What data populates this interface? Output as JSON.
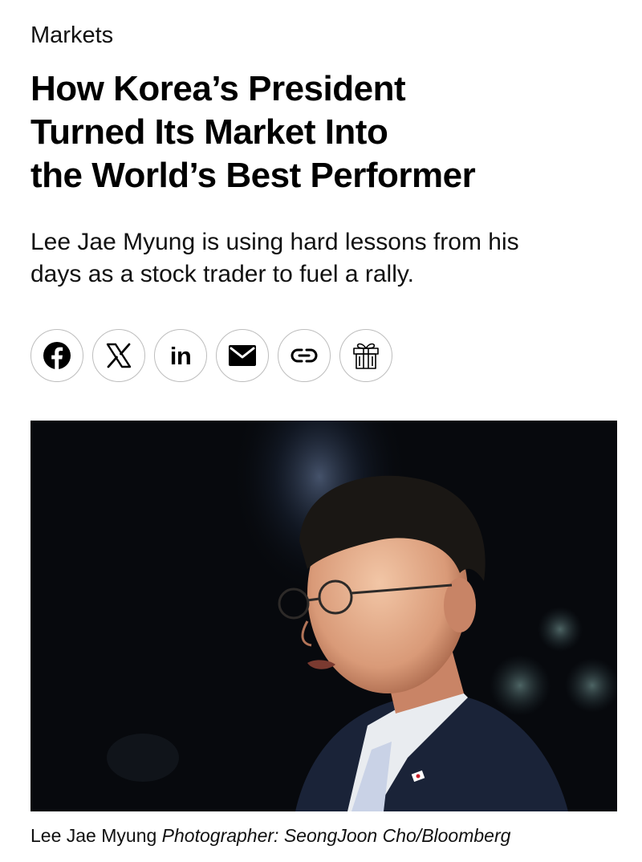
{
  "article": {
    "section": "Markets",
    "headline_lines": [
      "How Korea’s President",
      "Turned Its Market Into",
      "the World’s Best Performer"
    ],
    "dek_lines": [
      "Lee Jae Myung is using hard lessons from his",
      "days as a stock trader to fuel a rally."
    ]
  },
  "share": {
    "buttons": [
      {
        "icon": "facebook-icon"
      },
      {
        "icon": "x-icon"
      },
      {
        "icon": "linkedin-icon",
        "text": "in"
      },
      {
        "icon": "mail-icon"
      },
      {
        "icon": "link-icon"
      },
      {
        "icon": "gift-icon"
      }
    ]
  },
  "photo": {
    "caption_subject": "Lee Jae Myung",
    "caption_credit": "Photographer: SeongJoon Cho/Bloomberg"
  },
  "colors": {
    "text": "#000000",
    "button_border": "#bdbdbd",
    "photo_background": "#07090d"
  }
}
